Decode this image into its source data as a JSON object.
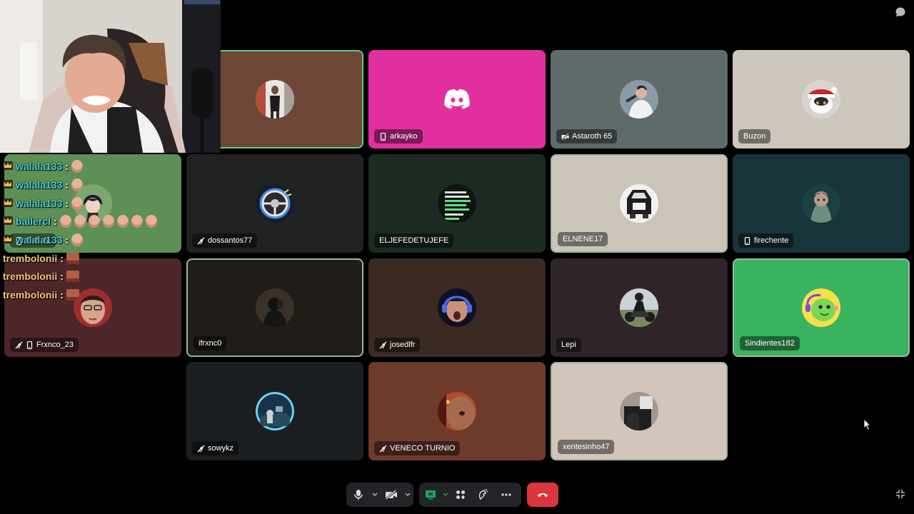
{
  "webcam": {
    "label": "Streamer webcam"
  },
  "chat": [
    {
      "user": "walala133",
      "sep": ":",
      "emotes": 1,
      "color": "#4bd0d8"
    },
    {
      "user": "walala133",
      "sep": ":",
      "emotes": 1,
      "color": "#4bd0d8"
    },
    {
      "user": "walala133",
      "sep": ":",
      "emotes": 1,
      "color": "#4bd0d8"
    },
    {
      "user": "ballercl",
      "sep": ":",
      "emotes": 7,
      "color": "#4bd0d8"
    },
    {
      "user": "walala133",
      "sep": ":",
      "emotes": 1,
      "color": "#4bd0d8"
    },
    {
      "user": "trembolonii",
      "sep": ":",
      "emotes": 1,
      "color": "#f1c878"
    },
    {
      "user": "trembolonii",
      "sep": ":",
      "emotes": 1,
      "color": "#f1c878"
    },
    {
      "user": "trembolonii",
      "sep": ":",
      "emotes": 1,
      "color": "#f1c878"
    }
  ],
  "tiles": [
    {
      "name": "",
      "bg": "#6e4638",
      "icons": [],
      "avatar": "person-standing"
    },
    {
      "name": "arkayko",
      "bg": "#e22f9f",
      "icons": [
        "phone"
      ],
      "avatar": "discord-logo"
    },
    {
      "name": "Astaroth 65",
      "bg": "#5f6b6b",
      "icons": [
        "video-off"
      ],
      "avatar": "person"
    },
    {
      "name": "Buzon",
      "bg": "#cdc6bc",
      "icons": [],
      "avatar": "cat"
    },
    {
      "name": "Cabala",
      "bg": "#5d8f56",
      "icons": [
        "phone"
      ],
      "avatar": "anime"
    },
    {
      "name": "dossantos77",
      "bg": "#202222",
      "icons": [
        "mute"
      ],
      "avatar": "steering-wheel"
    },
    {
      "name": "ELJEFEDETUJEFE",
      "bg": "#1b2b22",
      "icons": [],
      "avatar": "text-image"
    },
    {
      "name": "ELNENE17",
      "bg": "#cbc5b9",
      "icons": [],
      "avatar": "car"
    },
    {
      "name": "firechente",
      "bg": "#16343a",
      "icons": [
        "phone"
      ],
      "avatar": "creature"
    },
    {
      "name": "Frxnco_23",
      "bg": "#4d2629",
      "icons": [
        "mute",
        "phone"
      ],
      "avatar": "face"
    },
    {
      "name": "ifrxnc0",
      "bg": "#201c18",
      "icons": [],
      "avatar": "dark-figure"
    },
    {
      "name": "josedlfr",
      "bg": "#3a2a22",
      "icons": [
        "mute"
      ],
      "avatar": "headset-face"
    },
    {
      "name": "Lepi",
      "bg": "#2f2528",
      "icons": [],
      "avatar": "motorbike"
    },
    {
      "name": "Sindientes182",
      "bg": "#3ab360",
      "icons": [],
      "avatar": "green-cartoon"
    },
    {
      "name": "sowykz",
      "bg": "#1b1e21",
      "icons": [
        "mute"
      ],
      "avatar": "blue-ring"
    },
    {
      "name": "VENECO TURNIO",
      "bg": "#6d3a2c",
      "icons": [
        "mute"
      ],
      "avatar": "closeup-face"
    },
    {
      "name": "xentesinho47",
      "bg": "#d3c5b9",
      "icons": [],
      "avatar": "hand-object"
    }
  ],
  "controls": {
    "mic": "microphone-icon",
    "camera": "camera-off-icon",
    "screen": "screen-share-icon",
    "activities": "activities-icon",
    "soundboard": "soundboard-icon",
    "more": "more-icon",
    "leave": "leave-call-icon",
    "leave_color": "#da373c"
  }
}
